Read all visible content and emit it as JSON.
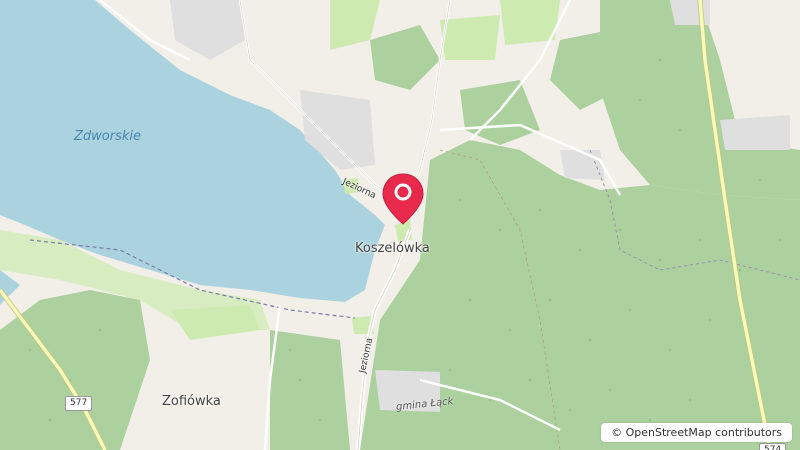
{
  "map": {
    "lake_label": "Zdworskie",
    "places": {
      "koszelowka": "Koszelówka",
      "zofiowka": "Zofiówka"
    },
    "roads": {
      "jeziorna_north": "Jeziorna",
      "jeziorna_south": "Jeziorna"
    },
    "admin_label": "gmina Łąck",
    "shields": {
      "r577": "577",
      "r574": "574"
    },
    "attribution": {
      "symbol": "©",
      "text": "OpenStreetMap contributors"
    },
    "marker": {
      "color": "#e8294c"
    },
    "colors": {
      "water": "#aad3df",
      "forest": "#add19e",
      "meadow": "#cdebb0",
      "land": "#f2efe9",
      "road_major": "#f7fabf",
      "residential": "#e0dfdf"
    }
  }
}
